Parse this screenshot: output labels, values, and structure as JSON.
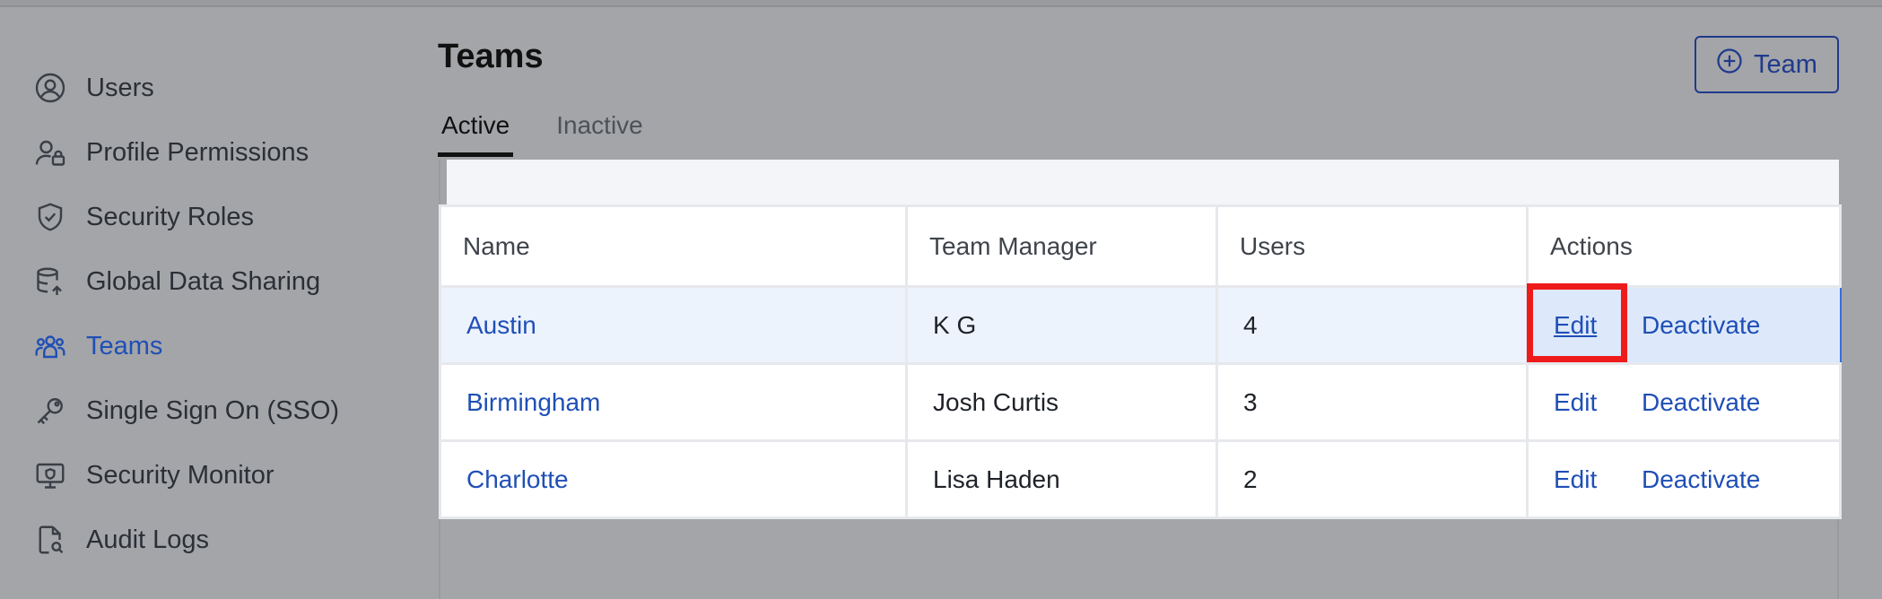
{
  "sidebar": {
    "items": [
      {
        "label": "Users",
        "icon": "user-circle-icon"
      },
      {
        "label": "Profile Permissions",
        "icon": "user-lock-icon"
      },
      {
        "label": "Security Roles",
        "icon": "shield-check-icon"
      },
      {
        "label": "Global Data Sharing",
        "icon": "database-share-icon"
      },
      {
        "label": "Teams",
        "icon": "team-icon",
        "active": true
      },
      {
        "label": "Single Sign On (SSO)",
        "icon": "key-icon"
      },
      {
        "label": "Security Monitor",
        "icon": "monitor-icon"
      },
      {
        "label": "Audit Logs",
        "icon": "file-search-icon"
      }
    ]
  },
  "page": {
    "title": "Teams",
    "add_team_label": "Team"
  },
  "tabs": [
    {
      "label": "Active",
      "active": true
    },
    {
      "label": "Inactive",
      "active": false
    }
  ],
  "table": {
    "columns": [
      "Name",
      "Team Manager",
      "Users",
      "Actions"
    ],
    "rows": [
      {
        "name": "Austin",
        "manager": "K G",
        "users": "4",
        "edit": "Edit",
        "deactivate": "Deactivate",
        "highlighted": true
      },
      {
        "name": "Birmingham",
        "manager": "Josh Curtis",
        "users": "3",
        "edit": "Edit",
        "deactivate": "Deactivate"
      },
      {
        "name": "Charlotte",
        "manager": "Lisa Haden",
        "users": "2",
        "edit": "Edit",
        "deactivate": "Deactivate"
      }
    ]
  },
  "colors": {
    "accent": "#1f4fb6",
    "highlight_box": "#ee1b1b",
    "overlay_bg": "#a4a5a8"
  }
}
